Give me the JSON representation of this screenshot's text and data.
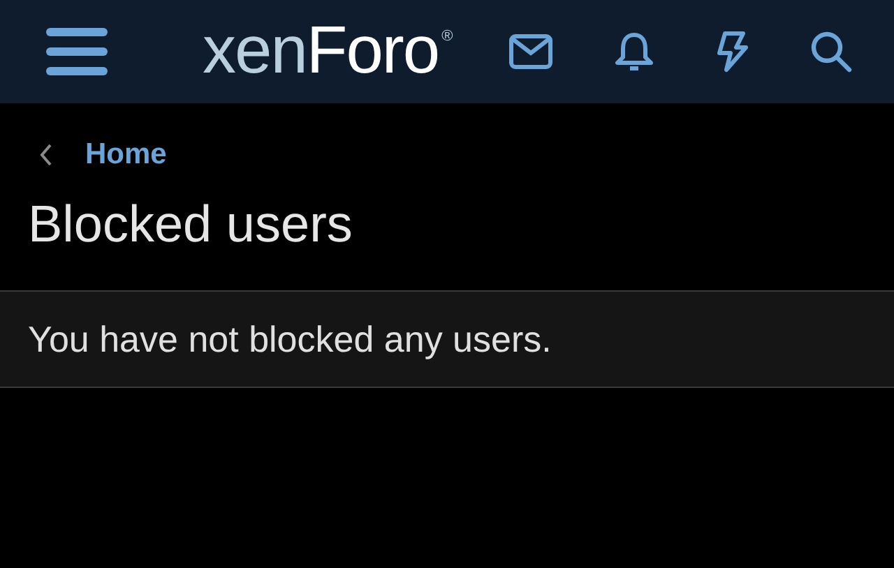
{
  "header": {
    "logo": {
      "prefix": "xen",
      "name": "Foro",
      "mark": "®"
    }
  },
  "breadcrumb": {
    "back": "Home"
  },
  "page_title": "Blocked users",
  "message": "You have not blocked any users."
}
